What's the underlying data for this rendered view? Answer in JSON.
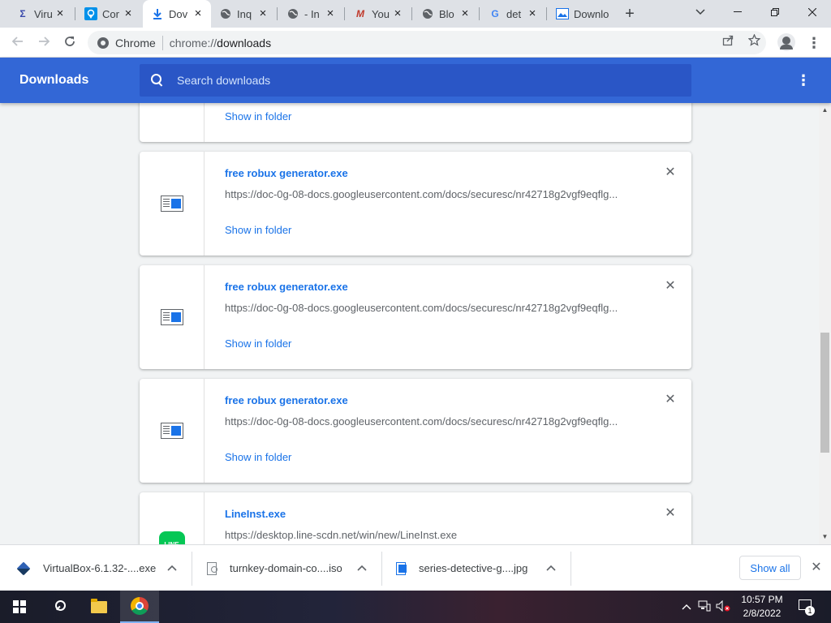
{
  "tabs": [
    {
      "title": "Viru",
      "icon": "sigma-icon",
      "color": "#3949ab"
    },
    {
      "title": "Cor",
      "icon": "location-icon",
      "color": "#0091ea"
    },
    {
      "title": "Dov",
      "icon": "download-icon",
      "color": "#1a73e8"
    },
    {
      "title": "Inq",
      "icon": "globe-icon",
      "color": "#5f6368"
    },
    {
      "title": "- In",
      "icon": "globe-icon",
      "color": "#5f6368"
    },
    {
      "title": "You",
      "icon": "m-icon",
      "color": "#c0392b"
    },
    {
      "title": "Blo",
      "icon": "globe-icon",
      "color": "#5f6368"
    },
    {
      "title": "det",
      "icon": "google-icon",
      "color": "#4285f4"
    },
    {
      "title": "Downlo",
      "icon": "picture-icon",
      "color": "#1a73e8"
    }
  ],
  "omnibox": {
    "site_label": "Chrome",
    "url_scheme": "chrome://",
    "url_path": "downloads"
  },
  "header": {
    "title": "Downloads",
    "search_placeholder": "Search downloads"
  },
  "downloads": [
    {
      "name": "",
      "url": "",
      "action": "Show in folder",
      "icon": "file-icon"
    },
    {
      "name": "free robux generator.exe",
      "url": "https://doc-0g-08-docs.googleusercontent.com/docs/securesc/nr42718g2vgf9eqflg...",
      "action": "Show in folder",
      "icon": "file-icon"
    },
    {
      "name": "free robux generator.exe",
      "url": "https://doc-0g-08-docs.googleusercontent.com/docs/securesc/nr42718g2vgf9eqflg...",
      "action": "Show in folder",
      "icon": "file-icon"
    },
    {
      "name": "free robux generator.exe",
      "url": "https://doc-0g-08-docs.googleusercontent.com/docs/securesc/nr42718g2vgf9eqflg...",
      "action": "Show in folder",
      "icon": "file-icon"
    },
    {
      "name": "LineInst.exe",
      "url": "https://desktop.line-scdn.net/win/new/LineInst.exe",
      "action": "",
      "icon": "line-icon",
      "icon_text": "LINE"
    }
  ],
  "shelf": {
    "items": [
      {
        "name": "VirtualBox-6.1.32-....exe",
        "icon": "virtualbox-icon"
      },
      {
        "name": "turnkey-domain-co....iso",
        "icon": "disc-file-icon"
      },
      {
        "name": "series-detective-g....jpg",
        "icon": "image-file-icon"
      }
    ],
    "show_all_label": "Show all"
  },
  "taskbar": {
    "time": "10:57 PM",
    "date": "2/8/2022",
    "notification_count": "1"
  },
  "colors": {
    "accent": "#3367d6",
    "link": "#1a73e8",
    "page_bg": "#f1f3f4"
  }
}
